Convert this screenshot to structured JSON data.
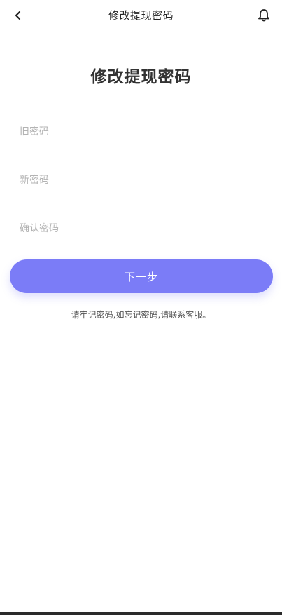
{
  "header": {
    "title": "修改提现密码",
    "back_icon": "chevron-left-icon",
    "bell_icon": "bell-icon"
  },
  "main": {
    "title": "修改提现密码",
    "fields": {
      "old_password_placeholder": "旧密码",
      "new_password_placeholder": "新密码",
      "confirm_password_placeholder": "确认密码"
    },
    "next_label": "下一步",
    "hint": "请牢记密码,如忘记密码,请联系客服。"
  },
  "colors": {
    "accent": "#7b7cf7",
    "text": "#333333",
    "placeholder": "#b3b3b3"
  }
}
